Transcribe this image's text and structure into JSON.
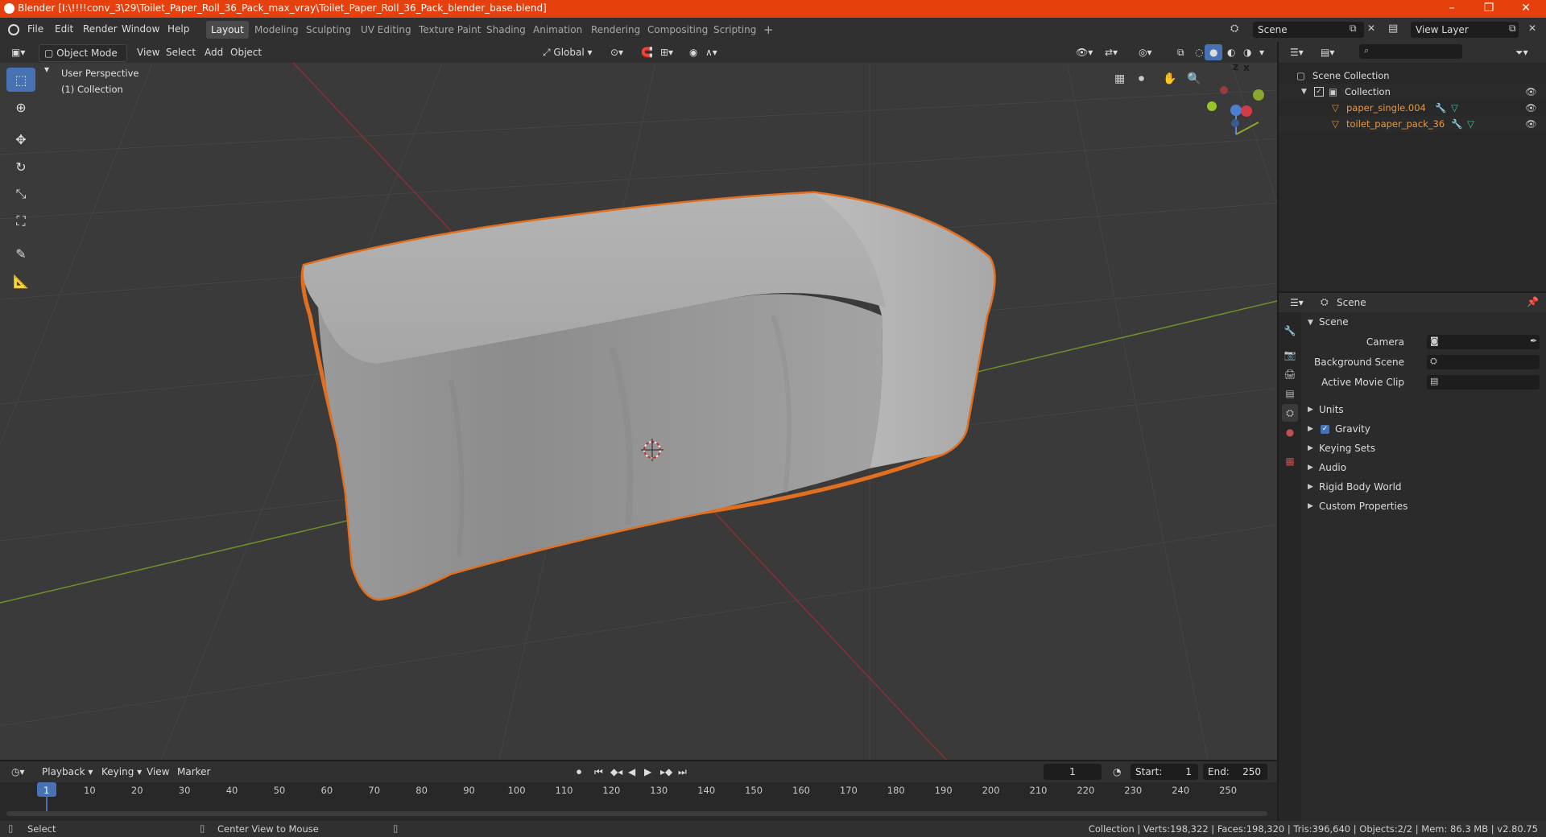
{
  "window": {
    "title": "Blender [I:\\!!!!conv_3\\29\\Toilet_Paper_Roll_36_Pack_max_vray\\Toilet_Paper_Roll_36_Pack_blender_base.blend]",
    "controls": {
      "minimize": "–",
      "maximize": "❐",
      "close": "✕"
    }
  },
  "menu": [
    "File",
    "Edit",
    "Render",
    "Window",
    "Help"
  ],
  "workspaces": [
    "Layout",
    "Modeling",
    "Sculpting",
    "UV Editing",
    "Texture Paint",
    "Shading",
    "Animation",
    "Rendering",
    "Compositing",
    "Scripting"
  ],
  "active_workspace": "Layout",
  "add_workspace": "+",
  "scene_field": "Scene",
  "view_layer_field": "View Layer",
  "viewport": {
    "mode": "Object Mode",
    "menus": [
      "View",
      "Select",
      "Add",
      "Object"
    ],
    "transform_orientation": "Global",
    "overlay_text": [
      "User Perspective",
      "(1) Collection"
    ],
    "gizmo_axes": {
      "x": "X",
      "y": "Y",
      "z": "Z"
    },
    "colors": {
      "selection_outline": "#e07020",
      "x_axis": "#8b2f35",
      "y_axis": "#6f8f2a",
      "background": "#3a3a3a"
    }
  },
  "outliner": {
    "root": "Scene Collection",
    "collection": "Collection",
    "objects": [
      "paper_single.004",
      "toilet_paper_pack_36"
    ]
  },
  "properties": {
    "header": "Scene",
    "panel_title": "Scene",
    "fields": [
      {
        "label": "Camera",
        "value": ""
      },
      {
        "label": "Background Scene",
        "value": ""
      },
      {
        "label": "Active Movie Clip",
        "value": ""
      }
    ],
    "sections": [
      "Units",
      "Gravity",
      "Keying Sets",
      "Audio",
      "Rigid Body World",
      "Custom Properties"
    ]
  },
  "timeline": {
    "menus": [
      "Playback",
      "Keying",
      "View",
      "Marker"
    ],
    "current_frame": "1",
    "start_label": "Start:",
    "start": "1",
    "end_label": "End:",
    "end": "250",
    "ticks": [
      "1",
      "10",
      "20",
      "30",
      "40",
      "50",
      "60",
      "70",
      "80",
      "90",
      "100",
      "110",
      "120",
      "130",
      "140",
      "150",
      "160",
      "170",
      "180",
      "190",
      "200",
      "210",
      "220",
      "230",
      "240",
      "250"
    ]
  },
  "statusbar": {
    "left": "Select",
    "middle": "Center View to Mouse",
    "right": "Collection | Verts:198,322 | Faces:198,320 | Tris:396,640 | Objects:2/2 | Mem: 86.3 MB | v2.80.75"
  }
}
